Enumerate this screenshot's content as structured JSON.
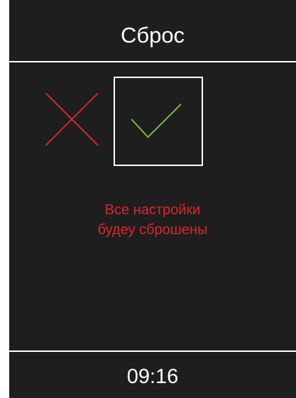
{
  "header": {
    "title": "Сброс"
  },
  "dialog": {
    "cancel_icon": "cross-icon",
    "confirm_icon": "check-icon",
    "message_line1": "Все настройки",
    "message_line2": "будеу сброшены"
  },
  "footer": {
    "time": "09:16"
  },
  "colors": {
    "background": "#1e1e1e",
    "text": "#ffffff",
    "cancel": "#d9262e",
    "confirm": "#7cbf3f",
    "warning": "#d9262e",
    "selection_border": "#ffffff"
  }
}
